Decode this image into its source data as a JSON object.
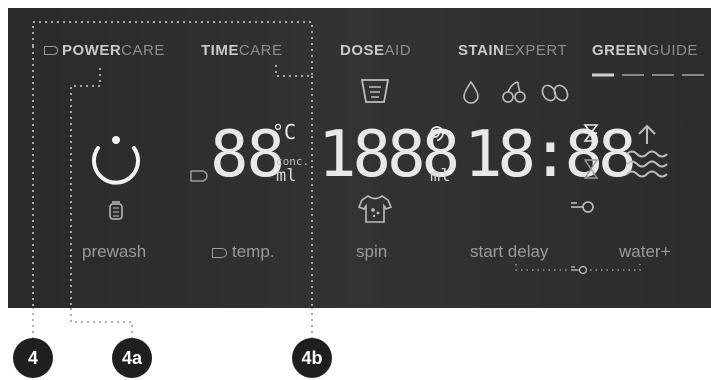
{
  "top_labels": {
    "powercare": {
      "bold": "POWER",
      "rest": "CARE"
    },
    "timecare": {
      "bold": "TIME",
      "rest": "CARE"
    },
    "doseaid": {
      "bold": "DOSE",
      "rest": "AID"
    },
    "stainexpert": {
      "bold": "STAIN",
      "rest": "EXPERT"
    },
    "greenguide": {
      "bold": "GREEN",
      "rest": "GUIDE"
    }
  },
  "displays": {
    "temp_value": "88",
    "temp_unit": "°C",
    "conc_label": "conc.",
    "ml_label": "ml",
    "spin_value": "1888",
    "spin_ml": "ml",
    "time_value": "18:88"
  },
  "bottom_labels": {
    "prewash": "prewash",
    "temp": "temp.",
    "spin": "spin",
    "start_delay": "start delay",
    "water_plus": "water+"
  },
  "callouts": {
    "c4": "4",
    "c4a": "4a",
    "c4b": "4b"
  },
  "icons": [
    "power-icon",
    "drop-icon",
    "cherries-icon",
    "coffee-bean-icon",
    "measuring-cup-icon",
    "shirt-stain-icon",
    "spiral-icon",
    "hourglass-icon",
    "key-lock-icon",
    "water-waves-icon",
    "bin-icon"
  ],
  "colors": {
    "panel": "#2e2e2e",
    "label": "#9a9a9a",
    "segment": "#e8e8e8",
    "callout": "#1f1f1f",
    "dotted_line": "#9a9a9a"
  }
}
